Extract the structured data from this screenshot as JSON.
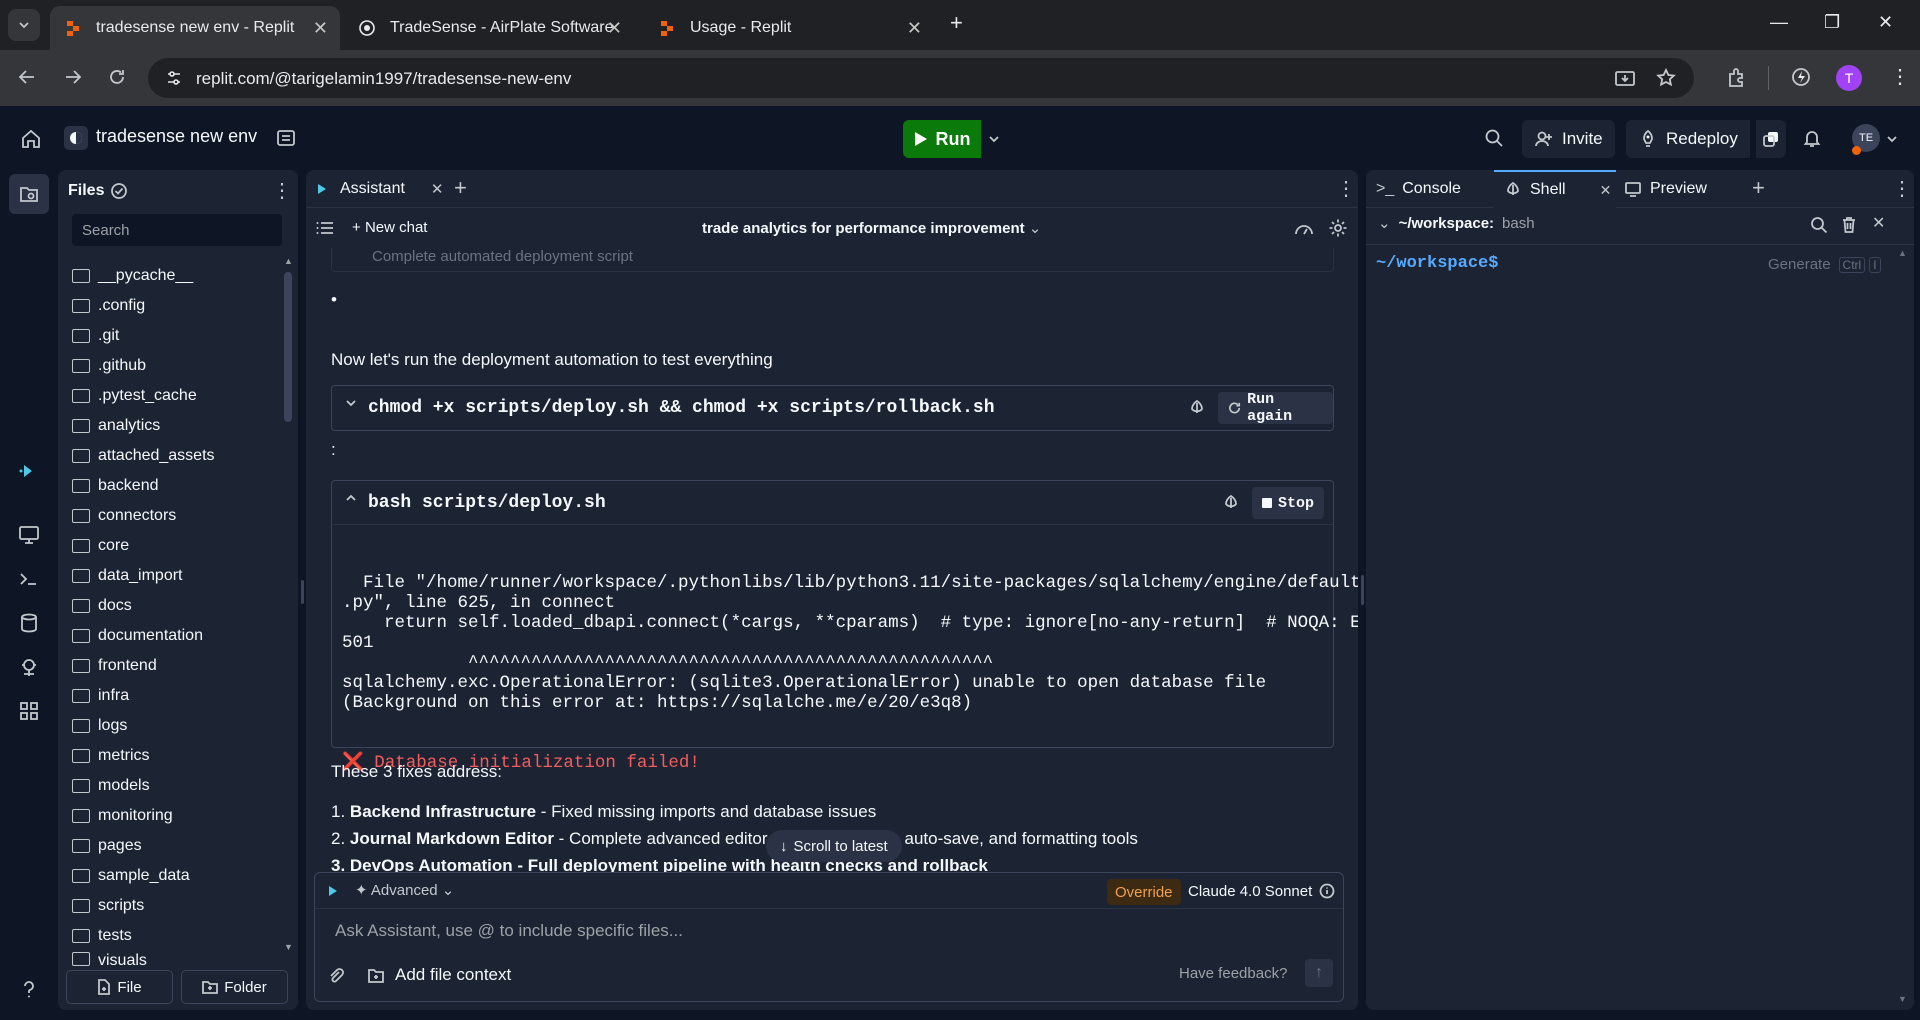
{
  "browser": {
    "tabs": [
      {
        "title": "tradesense new env - Replit",
        "active": true
      },
      {
        "title": "TradeSense - AirPlate Software",
        "active": false
      },
      {
        "title": "Usage - Replit",
        "active": false
      }
    ],
    "url": "replit.com/@tarigelamin1997/tradesense-new-env",
    "profile_initial": "T"
  },
  "header": {
    "project_name": "tradesense new env",
    "run_label": "Run",
    "invite_label": "Invite",
    "redeploy_label": "Redeploy",
    "avatar_initials": "TE"
  },
  "files": {
    "title": "Files",
    "search_placeholder": "Search",
    "items": [
      "__pycache__",
      ".config",
      ".git",
      ".github",
      ".pytest_cache",
      "analytics",
      "attached_assets",
      "backend",
      "connectors",
      "core",
      "data_import",
      "docs",
      "documentation",
      "frontend",
      "infra",
      "logs",
      "metrics",
      "models",
      "monitoring",
      "pages",
      "sample_data",
      "scripts",
      "tests",
      "visuals"
    ],
    "new_file_label": "File",
    "new_folder_label": "Folder"
  },
  "assistant": {
    "tab_label": "Assistant",
    "new_chat_label": "New chat",
    "chat_title": "trade analytics for performance improvement",
    "faded_line": "Complete automated deployment script",
    "bullet": "•",
    "intro": "Now let's run the deployment automation to test everything",
    "cmd1": "chmod +x scripts/deploy.sh && chmod +x scripts/rollback.sh",
    "run_again_label": "Run again",
    "colon": ":",
    "cmd2": "bash scripts/deploy.sh",
    "stop_label": "Stop",
    "output_lines": [
      "  File \"/home/runner/workspace/.pythonlibs/lib/python3.11/site-packages/sqlalchemy/engine/default",
      ".py\", line 625, in connect",
      "    return self.loaded_dbapi.connect(*cargs, **cparams)  # type: ignore[no-any-return]  # NOQA: E",
      "501",
      "            ^^^^^^^^^^^^^^^^^^^^^^^^^^^^^^^^^^^^^^^^^^^^^^^^^^",
      "sqlalchemy.exc.OperationalError: (sqlite3.OperationalError) unable to open database file",
      "(Background on this error at: https://sqlalche.me/e/20/e3q8)"
    ],
    "error_line": "❌ Database initialization failed!",
    "fixes_intro": "These 3 fixes address:",
    "fix1_num": "1.",
    "fix1_bold": "Backend Infrastructure",
    "fix1_rest": " - Fixed missing imports and database issues",
    "fix2_num": "2.",
    "fix2_bold": "Journal Markdown Editor",
    "fix2_rest": " - Complete advanced editor with live preview, auto-save, and formatting tools",
    "fix3_partial": "3. DevOps Automation - Full deployment pipeline with health checks and rollback",
    "scroll_latest_label": "Scroll to latest",
    "advanced_label": "Advanced",
    "override_label": "Override",
    "model_label": "Claude 4.0 Sonnet",
    "input_placeholder": "Ask Assistant, use @ to include specific files...",
    "add_context_label": "Add file context",
    "feedback_label": "Have feedback?"
  },
  "shell": {
    "tabs": [
      {
        "label": "Console",
        "active": false
      },
      {
        "label": "Shell",
        "active": true
      },
      {
        "label": "Preview",
        "active": false
      }
    ],
    "path": "~/workspace:",
    "shell_name": "bash",
    "prompt": "~/workspace$",
    "generate_label": "Generate",
    "kbd1": "Ctrl",
    "kbd2": "I"
  },
  "colors": {
    "bg": "#0e1525",
    "panel": "#1c2333",
    "run": "#0a7a0a",
    "accent": "#57abff",
    "error": "#f65c5c",
    "override": "#f0a050"
  }
}
